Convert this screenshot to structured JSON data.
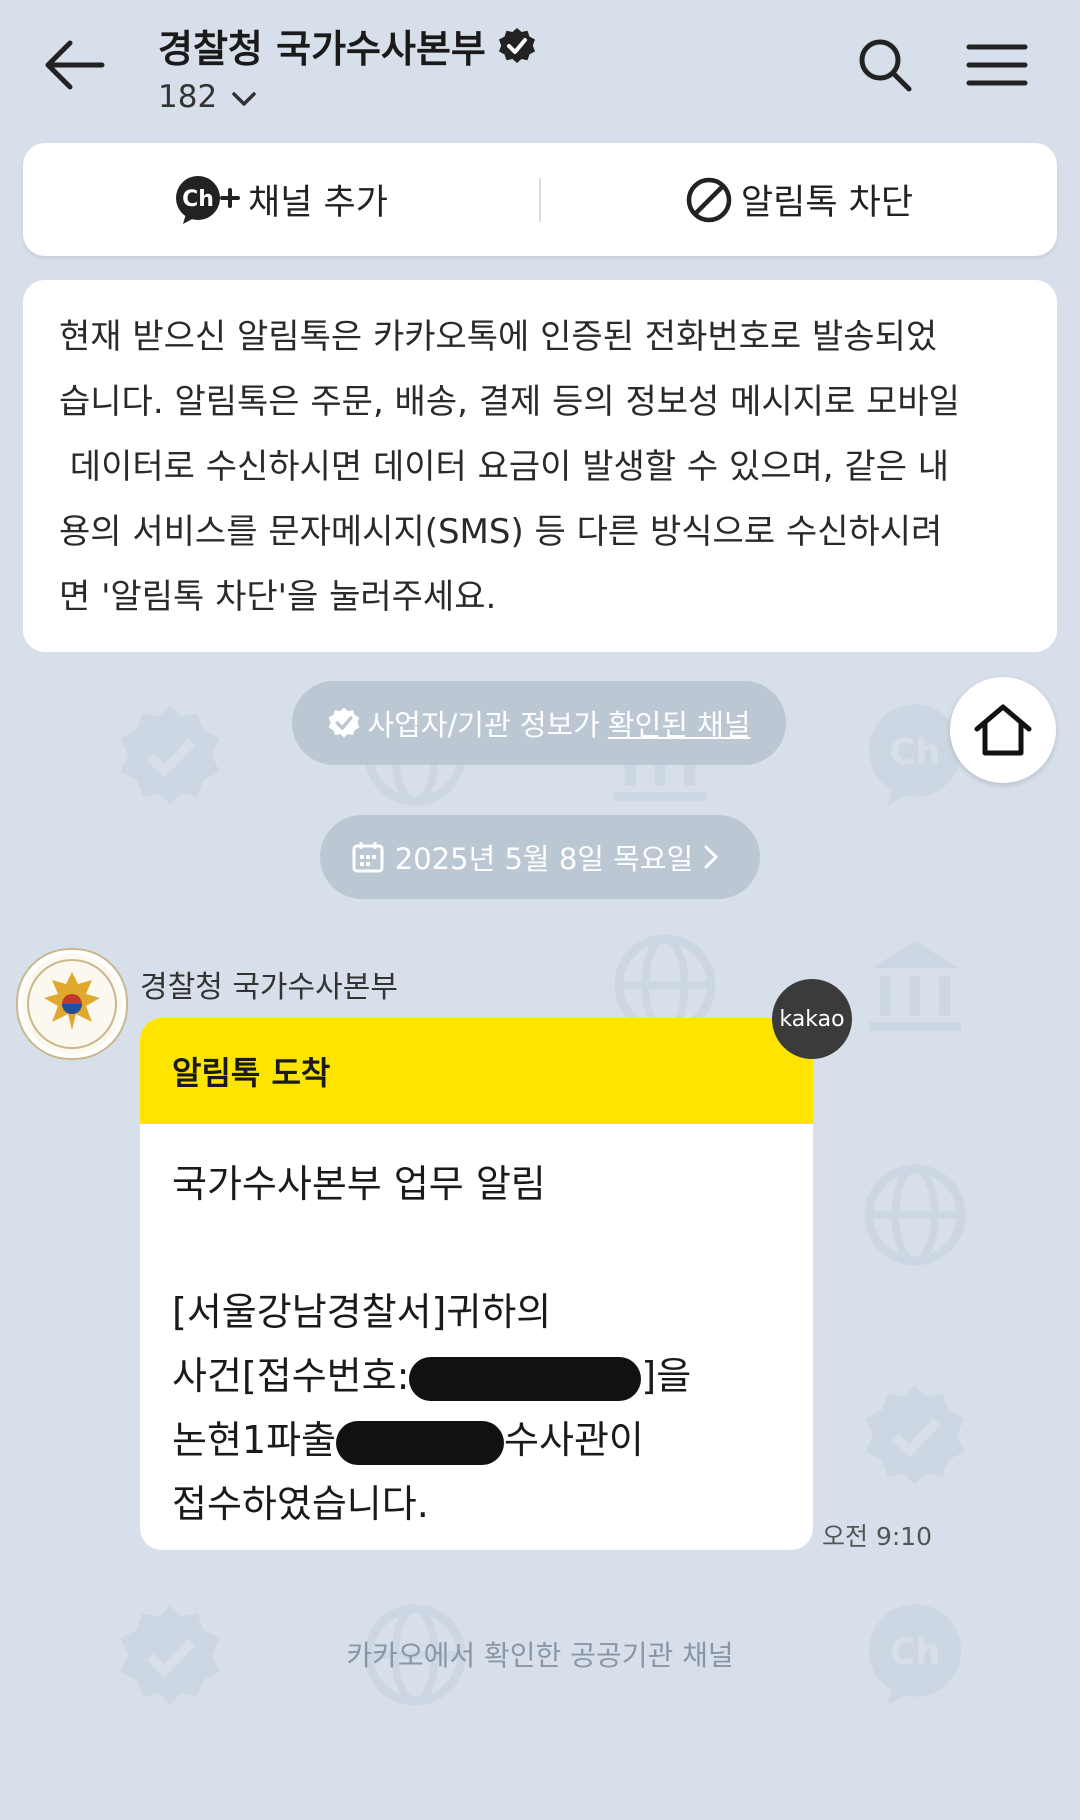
{
  "header": {
    "title": "경찰청 국가수사본부",
    "verified_icon": "verified-badge-icon",
    "follower_count": "182",
    "back_icon": "back-arrow-icon",
    "search_icon": "search-icon",
    "menu_icon": "hamburger-menu-icon"
  },
  "actions": {
    "add_channel_label": "채널 추가",
    "add_channel_icon": "channel-add-icon",
    "block_label": "알림톡 차단",
    "block_icon": "block-icon"
  },
  "notice": {
    "lines": [
      "현재 받으신 알림톡은 카카오톡에 인증된 전화번호로 발송되었",
      "습니다. 알림톡은 주문, 배송, 결제 등의 정보성 메시지로 모바일",
      " 데이터로 수신하시면 데이터 요금이 발생할 수 있으며, 같은 내",
      "용의 서비스를 문자메시지(SMS) 등 다른 방식으로 수신하시려",
      "면 '알림톡 차단'을 눌러주세요."
    ]
  },
  "info_pill": {
    "text": "사업자/기관 정보가",
    "link_text": "확인된 채널",
    "icon": "verified-check-icon"
  },
  "home_button_icon": "home-icon",
  "date_pill": {
    "label": "2025년 5월 8일 목요일",
    "icon": "calendar-icon"
  },
  "message": {
    "sender": "경찰청 국가수사본부",
    "avatar_icon": "police-emblem-icon",
    "badge": "kakao",
    "header": "알림톡 도착",
    "title": "국가수사본부 업무 알림",
    "line1": "[서울강남경찰서]귀하의",
    "line2_prefix": "사건[접수번호:",
    "line2_suffix": "]을",
    "line3_prefix": "논현1파출",
    "line3_suffix": "수사관이",
    "line4": "접수하였습니다.",
    "time": "오전 9:10"
  },
  "footer": {
    "note": "카카오에서 확인한 공공기관 채널"
  },
  "colors": {
    "background": "#d6dfea",
    "alimtalk_yellow": "#fee500",
    "pill": "#bcc7d4"
  }
}
